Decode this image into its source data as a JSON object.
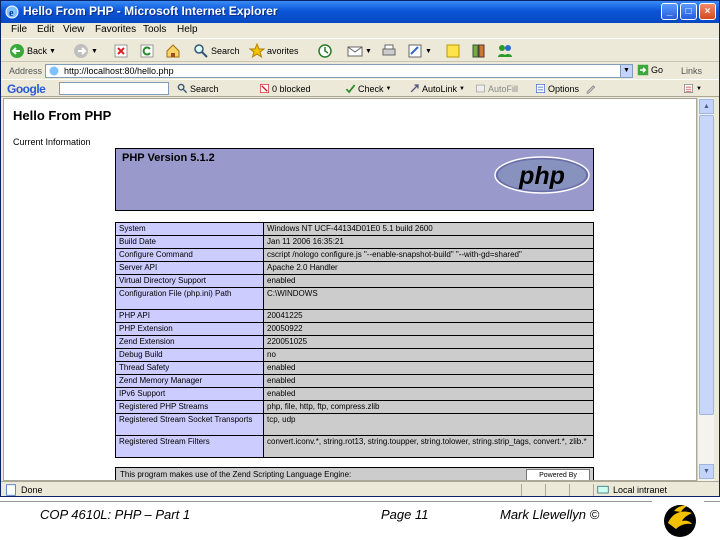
{
  "window": {
    "title": "Hello From PHP - Microsoft Internet Explorer"
  },
  "menu": [
    "File",
    "Edit",
    "View",
    "Favorites",
    "Tools",
    "Help"
  ],
  "toolbar": {
    "back": "Back",
    "search": "Search",
    "favorites": "avorites"
  },
  "address": {
    "label": "Address",
    "url": "http://localhost:80/hello.php",
    "go": "Go",
    "links": "Links"
  },
  "google": {
    "logo": "Google",
    "search": "Search",
    "blocked": "0 blocked",
    "check": "Check",
    "autolink": "AutoLink",
    "autofill": "AutoFill",
    "options": "Options"
  },
  "page": {
    "heading": "Hello From PHP",
    "subheading": "Current Information",
    "php_version": "PHP Version 5.1.2",
    "logo_text": "php",
    "rows": [
      {
        "key": "System",
        "value": "Windows NT UCF-44134D01E0 5.1 build 2600"
      },
      {
        "key": "Build Date",
        "value": "Jan 11 2006 16:35:21"
      },
      {
        "key": "Configure Command",
        "value": "cscript /nologo configure.js \"--enable-snapshot-build\" \"--with-gd=shared\""
      },
      {
        "key": "Server API",
        "value": "Apache 2.0 Handler"
      },
      {
        "key": "Virtual Directory Support",
        "value": "enabled"
      },
      {
        "key": "Configuration File (php.ini) Path",
        "value": "C:\\WINDOWS"
      },
      {
        "key": "PHP API",
        "value": "20041225"
      },
      {
        "key": "PHP Extension",
        "value": "20050922"
      },
      {
        "key": "Zend Extension",
        "value": "220051025"
      },
      {
        "key": "Debug Build",
        "value": "no"
      },
      {
        "key": "Thread Safety",
        "value": "enabled"
      },
      {
        "key": "Zend Memory Manager",
        "value": "enabled"
      },
      {
        "key": "IPv6 Support",
        "value": "enabled"
      },
      {
        "key": "Registered PHP Streams",
        "value": "php, file, http, ftp, compress.zlib"
      },
      {
        "key": "Registered Stream Socket Transports",
        "value": "tcp, udp"
      },
      {
        "key": "Registered Stream Filters",
        "value": "convert.iconv.*, string.rot13, string.toupper, string.tolower, string.strip_tags, convert.*, zlib.*"
      }
    ],
    "footer": "This program makes use of the Zend Scripting Language Engine:",
    "zend_badge": "Powered By"
  },
  "status": {
    "text": "Done",
    "zone": "Local intranet"
  },
  "slide": {
    "course": "COP 4610L: PHP – Part 1",
    "page": "Page 11",
    "author": "Mark Llewellyn ©"
  },
  "colors": {
    "titlebar": "#0a55d8",
    "php_header": "#9999cc",
    "key_cell": "#ccccff",
    "value_cell": "#cccccc"
  }
}
